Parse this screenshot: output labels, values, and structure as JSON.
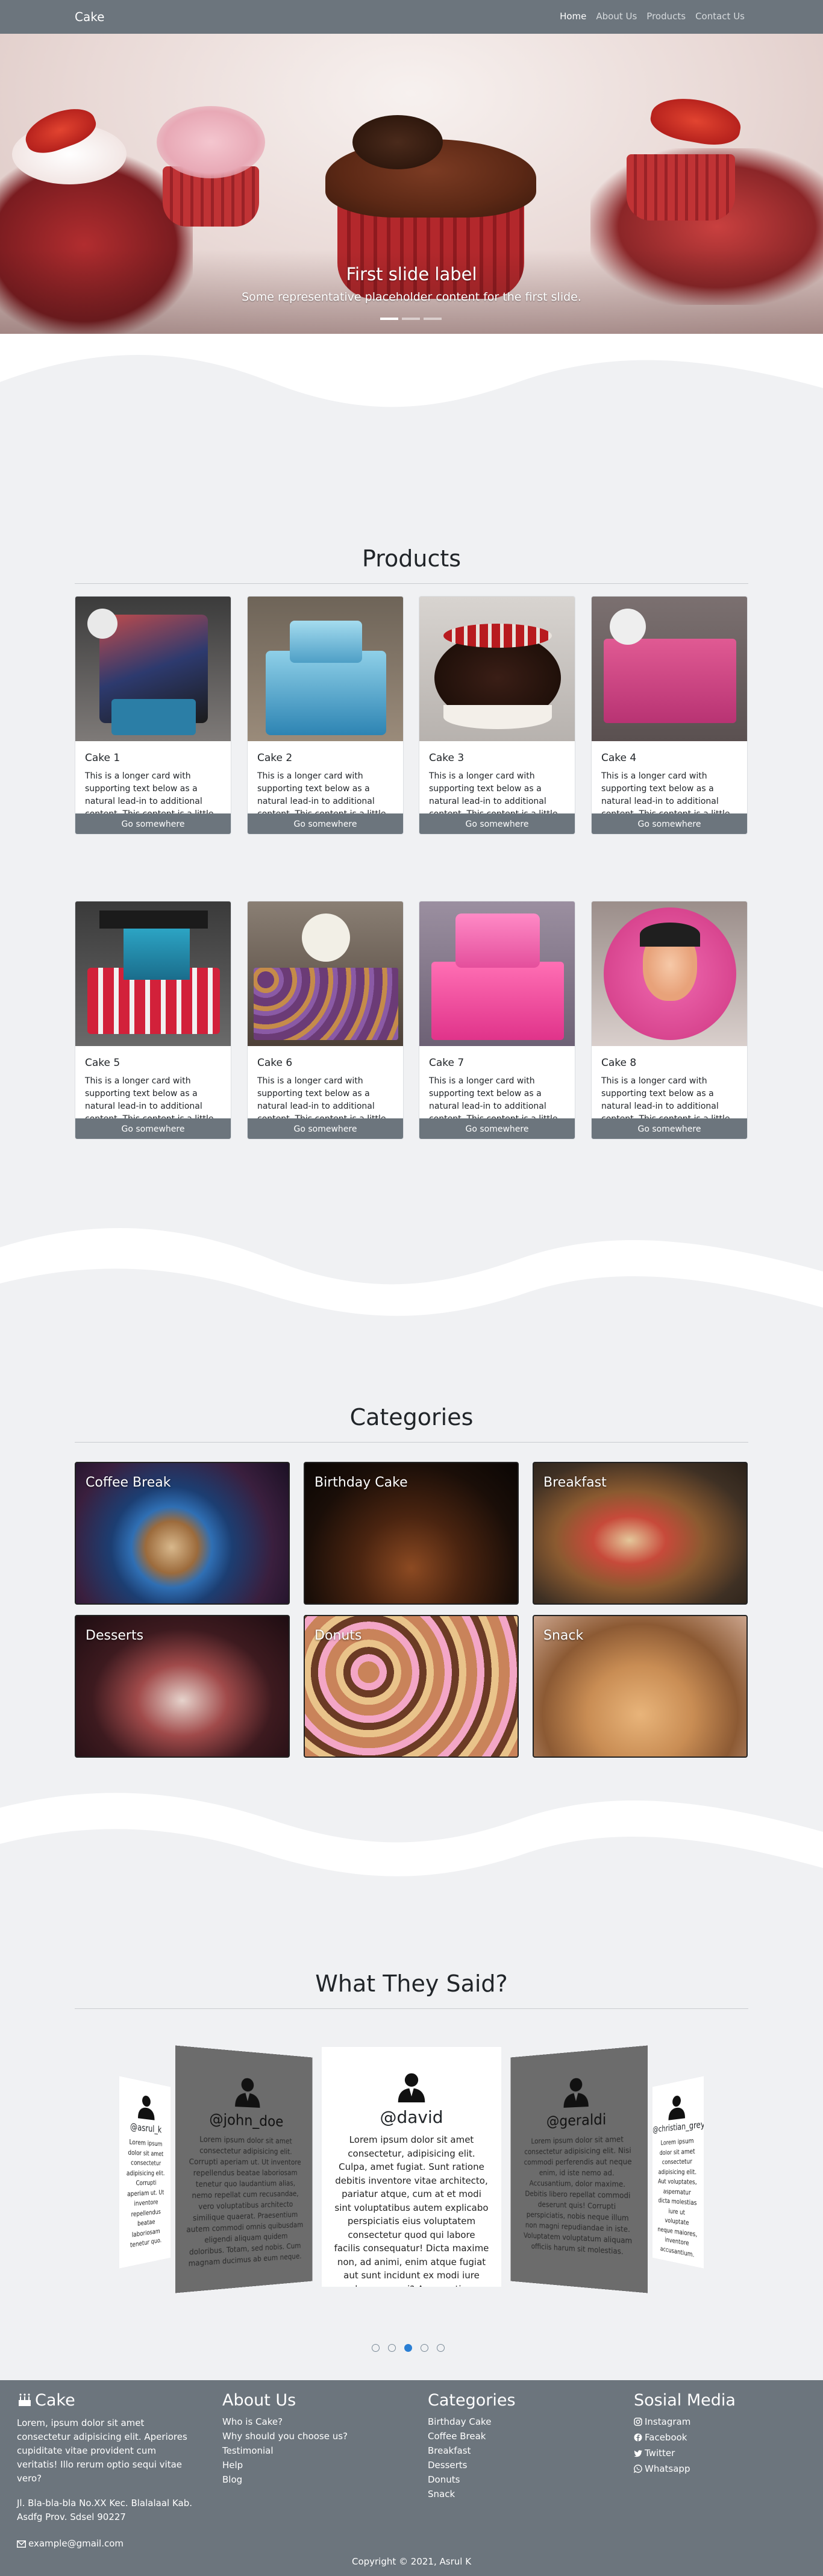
{
  "navbar": {
    "brand": "Cake",
    "links": [
      "Home",
      "About Us",
      "Products",
      "Contact Us"
    ],
    "active": "Home"
  },
  "hero": {
    "title": "First slide label",
    "text": "Some representative placeholder content for the first slide.",
    "slides": 3,
    "active_slide": 0
  },
  "products": {
    "title": "Products",
    "cards": [
      {
        "title": "Cake 1",
        "text": "This is a longer card with supporting text below as a natural lead-in to additional content. This content is a little bit longer.",
        "button": "Go somewhere"
      },
      {
        "title": "Cake 2",
        "text": "This is a longer card with supporting text below as a natural lead-in to additional content. This content is a little bit longer.",
        "button": "Go somewhere"
      },
      {
        "title": "Cake 3",
        "text": "This is a longer card with supporting text below as a natural lead-in to additional content. This content is a little bit longer.",
        "button": "Go somewhere"
      },
      {
        "title": "Cake 4",
        "text": "This is a longer card with supporting text below as a natural lead-in to additional content. This content is a little bit longer.",
        "button": "Go somewhere"
      },
      {
        "title": "Cake 5",
        "text": "This is a longer card with supporting text below as a natural lead-in to additional content. This content is a little bit longer.",
        "button": "Go somewhere"
      },
      {
        "title": "Cake 6",
        "text": "This is a longer card with supporting text below as a natural lead-in to additional content. This content is a little bit longer.",
        "button": "Go somewhere"
      },
      {
        "title": "Cake 7",
        "text": "This is a longer card with supporting text below as a natural lead-in to additional content. This content is a little bit longer.",
        "button": "Go somewhere"
      },
      {
        "title": "Cake 8",
        "text": "This is a longer card with supporting text below as a natural lead-in to additional content. This content is a little bit longer.",
        "button": "Go somewhere"
      }
    ]
  },
  "categories": {
    "title": "Categories",
    "items": [
      "Coffee Break",
      "Birthday Cake",
      "Breakfast",
      "Desserts",
      "Donuts",
      "Snack"
    ]
  },
  "testimonials": {
    "title": "What They Said?",
    "items": [
      {
        "name": "@asrul_k",
        "text": "Lorem ipsum dolor sit amet consectetur adipisicing elit. Corrupti aperiam ut. Ut inventore repellendus beatae laboriosam tenetur quo."
      },
      {
        "name": "@john_doe",
        "text": "Lorem ipsum dolor sit amet consectetur adipisicing elit. Corrupti aperiam ut. Ut inventore repellendus beatae laboriosam tenetur quo laudantium alias, nemo repellat cum recusandae, vero voluptatibus architecto similique quaerat. Praesentium autem commodi omnis quibusdam eligendi aliquam quidem doloribus. Totam, sed nobis. Cum magnam ducimus ab eum neque."
      },
      {
        "name": "@david",
        "text": "Lorem ipsum dolor sit amet consectetur, adipisicing elit. Culpa, amet fugiat. Sunt ratione debitis inventore vitae architecto, pariatur atque, cum at et modi sint voluptatibus autem explicabo perspiciatis eius voluptatem consectetur quod qui labore facilis consequatur! Dicta maxime non, ad animi, enim atque fugiat aut sunt incidunt ex modi iure culpa ea quasi? Accusantium."
      },
      {
        "name": "@geraldi",
        "text": "Lorem ipsum dolor sit amet consectetur adipisicing elit. Nisi commodi perferendis aut neque enim, id iste nemo ad. Accusantium, dolor maxime. Debitis libero repellat commodi deserunt quis! Corrupti perspiciatis, nobis neque illum non magni repudiandae in iste. Voluptatem voluptatum aliquam officiis harum sit molestias."
      },
      {
        "name": "@christian_grey",
        "text": "Lorem ipsum dolor sit amet consectetur adipisicing elit. Aut voluptates, aspernatur dicta molestias iure ut voluptate neque maiores, inventore accusantium."
      }
    ],
    "dots": 5,
    "active_dot": 2
  },
  "footer": {
    "brand": {
      "title": "Cake",
      "text": "Lorem, ipsum dolor sit amet consectetur adipisicing elit. Aperiores cupiditate vitae provident cum veritatis! Illo rerum optio sequi vitae vero?",
      "address": "Jl. Bla-bla-bla No.XX Kec. Blalalaal Kab. Asdfg Prov. Sdsel 90227",
      "email": "example@gmail.com"
    },
    "about": {
      "title": "About Us",
      "links": [
        "Who is Cake?",
        "Why should you choose us?",
        "Testimonial",
        "Help",
        "Blog"
      ]
    },
    "categories": {
      "title": "Categories",
      "links": [
        "Birthday Cake",
        "Coffee Break",
        "Breakfast",
        "Desserts",
        "Donuts",
        "Snack"
      ]
    },
    "social": {
      "title": "Sosial Media",
      "links": [
        "Instagram",
        "Facebook",
        "Twitter",
        "Whatsapp"
      ]
    },
    "copyright": "Copyright © 2021, Asrul K"
  },
  "colors": {
    "navbar": "#6c757d",
    "button": "#6c757d",
    "footer": "#6c757d",
    "page_bg": "#f0f1f3",
    "dot_active": "#2a7fd4"
  }
}
